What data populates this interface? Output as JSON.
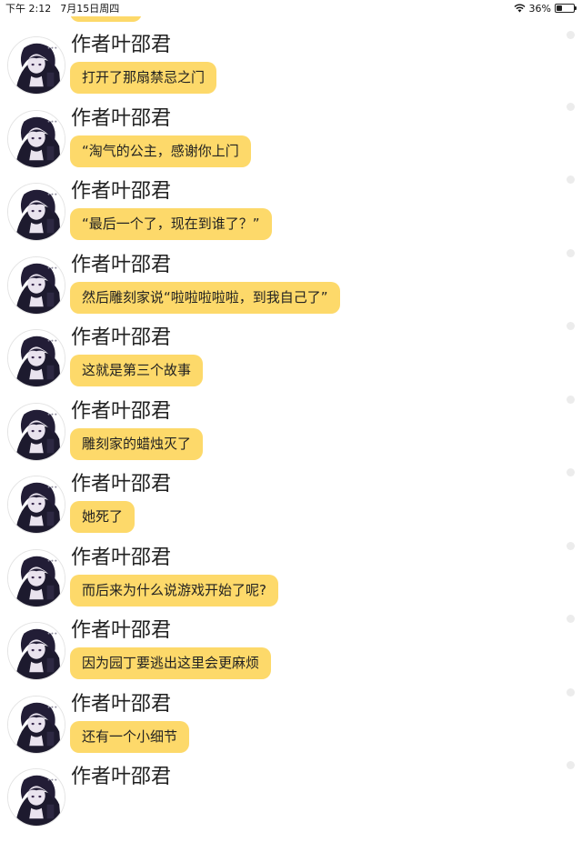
{
  "status_bar": {
    "time": "下午 2:12",
    "date": "7月15日周四",
    "battery": "36%",
    "battery_level": 0.36
  },
  "colors": {
    "bubble": "#fdd96a",
    "background": "#ffffff",
    "text": "#222222"
  },
  "messages": [
    {
      "sender": "作者叶邵君",
      "text": "打开了那扇禁忌之门"
    },
    {
      "sender": "作者叶邵君",
      "text": "“淘气的公主，感谢你上门"
    },
    {
      "sender": "作者叶邵君",
      "text": "“最后一个了，现在到谁了？”"
    },
    {
      "sender": "作者叶邵君",
      "text": "然后雕刻家说“啦啦啦啦啦，到我自己了”"
    },
    {
      "sender": "作者叶邵君",
      "text": "这就是第三个故事"
    },
    {
      "sender": "作者叶邵君",
      "text": "雕刻家的蜡烛灭了"
    },
    {
      "sender": "作者叶邵君",
      "text": "她死了"
    },
    {
      "sender": "作者叶邵君",
      "text": "而后来为什么说游戏开始了呢?"
    },
    {
      "sender": "作者叶邵君",
      "text": "因为园丁要逃出这里会更麻烦"
    },
    {
      "sender": "作者叶邵君",
      "text": "还有一个小细节"
    },
    {
      "sender": "作者叶邵君",
      "text": ""
    }
  ]
}
